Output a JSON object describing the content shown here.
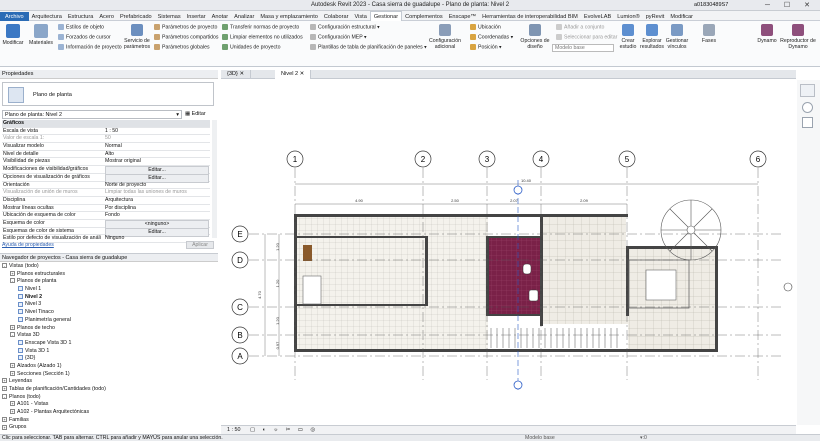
{
  "title_bar": {
    "title": "Autodesk Revit 2023 - Casa sierra de guadalupe - Plano de planta: Nivel 2",
    "user": "a01830489S7"
  },
  "menu": [
    "Archivo",
    "Arquitectura",
    "Estructura",
    "Acero",
    "Prefabricado",
    "Sistemas",
    "Insertar",
    "Anotar",
    "Analizar",
    "Masa y emplazamiento",
    "Colaborar",
    "Vista",
    "Gestionar",
    "Complementos",
    "Enscape™",
    "Herramientas de interoperabilidad BIM",
    "EvolveLAB",
    "Lumion®",
    "pyRevit",
    "Modificar"
  ],
  "menu_active": "Gestionar",
  "ribbon": {
    "modify": "Modificar",
    "materials": "Materiales",
    "objstyles": "Estilos de objeto",
    "snaps": "Forzados de cursor",
    "projinfo": "Información de proyecto",
    "projparams": "Parámetros de proyecto",
    "sharedparams": "Parámetros compartidos",
    "globalparams": "Parámetros globales",
    "transfer": "Transferir normas de proyecto",
    "purge": "Limpiar elementos no utilizados",
    "units": "Unidades de proyecto",
    "serviceparams": "Servicio de parámetros",
    "structsettings": "Configuración estructural",
    "mepsettings": "Configuración MEP",
    "paneltemplates": "Plantillas de tabla de planificación de paneles",
    "addsettings": "Configuración adicional",
    "location": "Ubicación",
    "coords": "Coordenadas",
    "position": "Posición",
    "designopts": "Opciones de diseño",
    "addset": "Añadir a conjunto",
    "pickedit": "Seleccionar para editar",
    "mainmodel": "Modelo base",
    "createstudy": "Crear estudio",
    "explore": "Explorar resultados",
    "manage_links": "Gestionar vínculos",
    "phases": "Fases",
    "dynamo": "Dynamo",
    "dynplayer": "Reproductor de Dynamo"
  },
  "properties": {
    "header": "Propiedades",
    "type": "Plano de planta",
    "view_dropdown": "Plano de planta: Nivel 2",
    "edit_type": "Editar tipo",
    "rows": [
      {
        "k": "Gráficos",
        "v": "",
        "cat": true
      },
      {
        "k": "Escala de vista",
        "v": "1 : 50"
      },
      {
        "k": "Valor de escala    1:",
        "v": "50",
        "grey": true
      },
      {
        "k": "Visualizar modelo",
        "v": "Normal"
      },
      {
        "k": "Nivel de detalle",
        "v": "Alto"
      },
      {
        "k": "Visibilidad de piezas",
        "v": "Mostrar original"
      },
      {
        "k": "Modificaciones de visibilidad/gráficos",
        "v": "Editar...",
        "btn": true
      },
      {
        "k": "Opciones de visualización de gráficos",
        "v": "Editar...",
        "btn": true
      },
      {
        "k": "Orientación",
        "v": "Norte de proyecto"
      },
      {
        "k": "Visualización de unión de muros",
        "v": "Limpiar todas las uniones de muros",
        "grey": true
      },
      {
        "k": "Disciplina",
        "v": "Arquitectura"
      },
      {
        "k": "Mostrar líneas ocultas",
        "v": "Por disciplina"
      },
      {
        "k": "Ubicación de esquema de color",
        "v": "Fondo"
      },
      {
        "k": "Esquema de color",
        "v": "<ninguno>",
        "btn": true
      },
      {
        "k": "Esquemas de color de sistema",
        "v": "Editar...",
        "btn": true
      },
      {
        "k": "Estilo por defecto de visualización de análi",
        "v": "Ninguno"
      }
    ],
    "help": "Ayuda de propiedades",
    "apply": "Aplicar"
  },
  "browser": {
    "header": "Navegador de proyectos - Casa sierra de guadalupe",
    "nodes": [
      {
        "t": "Vistas (todo)",
        "lvl": 0,
        "exp": "-"
      },
      {
        "t": "Planos estructurales",
        "lvl": 1,
        "exp": "+"
      },
      {
        "t": "Planos de planta",
        "lvl": 1,
        "exp": "-"
      },
      {
        "t": "Nivel 1",
        "lvl": 2,
        "v": true
      },
      {
        "t": "Nivel 2",
        "lvl": 2,
        "v": true,
        "sel": true
      },
      {
        "t": "Nivel 3",
        "lvl": 2,
        "v": true
      },
      {
        "t": "Nivel Tinaco",
        "lvl": 2,
        "v": true
      },
      {
        "t": "Planimetría general",
        "lvl": 2,
        "v": true
      },
      {
        "t": "Planos de techo",
        "lvl": 1,
        "exp": "+"
      },
      {
        "t": "Vistas 3D",
        "lvl": 1,
        "exp": "-"
      },
      {
        "t": "Enscape Vista 3D 1",
        "lvl": 2,
        "v": true
      },
      {
        "t": "Vista 3D 1",
        "lvl": 2,
        "v": true
      },
      {
        "t": "{3D}",
        "lvl": 2,
        "v": true
      },
      {
        "t": "Alzados (Alzado 1)",
        "lvl": 1,
        "exp": "+"
      },
      {
        "t": "Secciones (Sección 1)",
        "lvl": 1,
        "exp": "+"
      },
      {
        "t": "Leyendas",
        "lvl": 0,
        "exp": "+"
      },
      {
        "t": "Tablas de planificación/Cantidades (todo)",
        "lvl": 0,
        "exp": "+"
      },
      {
        "t": "Planos (todo)",
        "lvl": 0,
        "exp": "-"
      },
      {
        "t": "A101 - Vistas",
        "lvl": 1,
        "exp": "+"
      },
      {
        "t": "A102 - Plantas Arquitectónicas",
        "lvl": 1,
        "exp": "+"
      },
      {
        "t": "Familias",
        "lvl": 0,
        "exp": "+"
      },
      {
        "t": "Grupos",
        "lvl": 0,
        "exp": "+"
      }
    ]
  },
  "tabs": [
    {
      "label": "{3D}"
    },
    {
      "label": "Nivel 2",
      "active": true
    }
  ],
  "grid": {
    "cols": [
      "1",
      "2",
      "3",
      "4",
      "5",
      "6"
    ],
    "rows": [
      "E",
      "D",
      "C",
      "B",
      "A"
    ]
  },
  "dims": {
    "top_total": "10.40",
    "top_segments": [
      "4.90",
      "2.50",
      "2.07",
      "2.09"
    ],
    "left": [
      "1.20",
      "1.20",
      "1.20",
      "0.97"
    ],
    "left_total": "4.70"
  },
  "view_scale": "1 : 50",
  "status": "Clic para seleccionar. TAB para alternar. CTRL para añadir y MAYÚS para anular una selección.",
  "status_right": {
    "model": "Modelo base",
    "count": ":0"
  }
}
